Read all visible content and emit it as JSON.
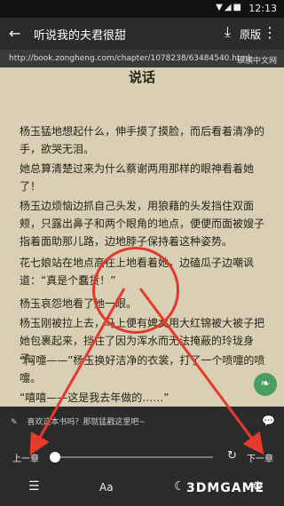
{
  "status": {
    "time": "12:13",
    "signals": "▼◢■"
  },
  "appbar": {
    "back": "←",
    "title": "听说我的夫君很甜",
    "download": "⤓",
    "original_label": "原版",
    "more": "⋮"
  },
  "url": {
    "address": "http://book.zongheng.com/chapter/1078238/63484540.html",
    "source": "纵横中文网"
  },
  "reader": {
    "chapter_title": "说话",
    "paragraphs": [
      "杨玉猛地想起什么，伸手摸了摸脸，而后看着清净的手，欲哭无泪。",
      "她总算清楚过来为什么蔡谢两用那样的眼神看着她了！",
      "杨玉边烦恼边抓自己头发，用狼藉的头发挡住双面颊，只露出鼻子和两个眼角的地点，便便而面被嫂子指着面助那儿路，边地脖子保持着这种姿势。",
      "花七娘站在地点高在上地看着她，边磕瓜子边嘲讽道：“真是个蠢货！”",
      "杨玉哀怨地看了她一眼。",
      "杨玉刚被拉上去，马上便有婢女用大红锦被大被子把她包裹起来，挡住了因为浑水而无法掩蔽的玲珑身子。",
      "“阿嚏——”杨玉换好洁净的衣裳，打了一个喷嚏的喷嚏。",
      "“嘻嘻——这是我去年做的……”"
    ]
  },
  "panel": {
    "pen": "✎",
    "ask_text": "喜欢这本书吗？那就猛戳这里吧~",
    "comment_icon": "💬",
    "prev_chapter": "上一章",
    "next_chapter": "下一章",
    "progress": 0.0,
    "refresh": "↻",
    "menu_icon": "☰",
    "font_label": "Aa",
    "night_icon": "☾",
    "settings_icon": "⚙"
  },
  "watermark": "3DMGAME"
}
